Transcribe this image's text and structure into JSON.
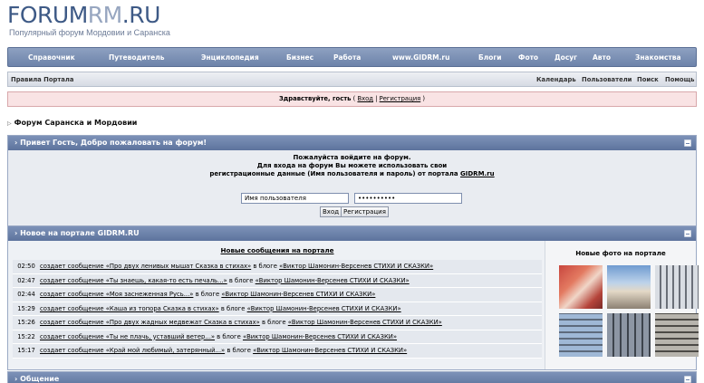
{
  "logo": {
    "part1": "FORUM",
    "part2": "RM",
    "part3": ".RU",
    "subtitle": "Популярный форум Мордовии и Саранска"
  },
  "topnav": [
    "Справочник",
    "Путеводитель",
    "Энциклопедия",
    "Бизнес",
    "Работа",
    "www.GIDRM.ru",
    "Блоги",
    "Фото",
    "Досуг",
    "Авто",
    "Знакомства"
  ],
  "subnav": {
    "left": "Правила Портала",
    "right": [
      "Календарь",
      "Пользователи",
      "Поиск",
      "Помощь"
    ]
  },
  "greeting": {
    "text": "Здравствуйте, гость",
    "open": "(",
    "login": "Вход",
    "sep": "|",
    "register": "Регистрация",
    "close": ")"
  },
  "breadcrumb": "Форум Саранска и Мордовии",
  "login_panel": {
    "title": "Привет Гость, Добро пожаловать на форум!",
    "line1": "Пожалуйста войдите на форум.",
    "line2": "Для входа на форум Вы можете использовать свои",
    "line3": "регистрационные данные (Имя пользователя и пароль) от портала",
    "portal": "GIDRM.ru",
    "username_placeholder": "Имя пользователя",
    "password_value": "••••••••••",
    "login_button": "Вход",
    "register_button": "Регистрация"
  },
  "news_panel": {
    "title": "Новое на портале GIDRM.RU",
    "messages_title": "Новые сообщения на портале",
    "photos_title": "Новые фото на портале",
    "items": [
      {
        "time": "02:50",
        "action": "создает сообщение «Про двух ленивых мышат Сказка в стихах»",
        "mid": " в блоге ",
        "blog": "«Виктор Шамонин-Версенев СТИХИ И СКАЗКИ»"
      },
      {
        "time": "02:47",
        "action": "создает сообщение «Ты знаешь, какая-то есть печаль...»",
        "mid": " в блоге ",
        "blog": "«Виктор Шамонин-Версенев СТИХИ И СКАЗКИ»"
      },
      {
        "time": "02:44",
        "action": "создает сообщение «Моя заснеженная Русь...»",
        "mid": " в блоге ",
        "blog": "«Виктор Шамонин-Версенев СТИХИ И СКАЗКИ»"
      },
      {
        "time": "15:29",
        "action": "создает сообщение «Каша из топора Сказка в стихах»",
        "mid": " в блоге ",
        "blog": "«Виктор Шамонин-Версенев СТИХИ И СКАЗКИ»"
      },
      {
        "time": "15:26",
        "action": "создает сообщение «Про двух жадных медвежат Сказка в стихах»",
        "mid": " в блоге ",
        "blog": "«Виктор Шамонин-Версенев СТИХИ И СКАЗКИ»"
      },
      {
        "time": "15:22",
        "action": "создает сообщение «Ты не плачь, уставший ветер...»",
        "mid": " в блоге ",
        "blog": "«Виктор Шамонин-Версенев СТИХИ И СКАЗКИ»"
      },
      {
        "time": "15:17",
        "action": "создает сообщение «Край мой любимый, затерянный...»",
        "mid": " в блоге ",
        "blog": "«Виктор Шамонин-Версенев СТИХИ И СКАЗКИ»"
      }
    ]
  },
  "bottom_panel": {
    "title": "Общение"
  }
}
